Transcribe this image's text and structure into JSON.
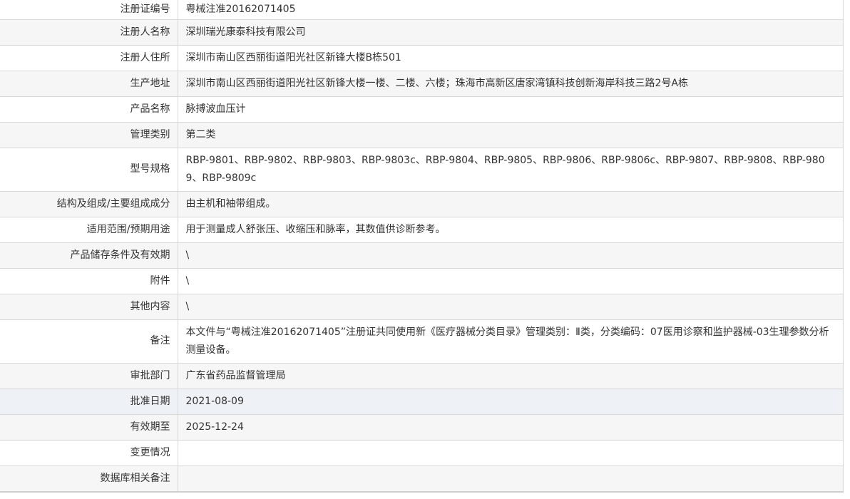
{
  "rows": [
    {
      "label": "注册证编号",
      "value": "粤械注准20162071405"
    },
    {
      "label": "注册人名称",
      "value": "深圳瑞光康泰科技有限公司"
    },
    {
      "label": "注册人住所",
      "value": "深圳市南山区西丽街道阳光社区新锋大楼B栋501"
    },
    {
      "label": "生产地址",
      "value": "深圳市南山区西丽街道阳光社区新锋大楼一楼、二楼、六楼；珠海市高新区唐家湾镇科技创新海岸科技三路2号A栋"
    },
    {
      "label": "产品名称",
      "value": "脉搏波血压计"
    },
    {
      "label": "管理类别",
      "value": "第二类"
    },
    {
      "label": "型号规格",
      "value": "RBP-9801、RBP-9802、RBP-9803、RBP-9803c、RBP-9804、RBP-9805、RBP-9806、RBP-9806c、RBP-9807、RBP-9808、RBP-9809、RBP-9809c"
    },
    {
      "label": "结构及组成/主要组成成分",
      "value": "由主机和袖带组成。"
    },
    {
      "label": "适用范围/预期用途",
      "value": "用于测量成人舒张压、收缩压和脉率，其数值供诊断参考。"
    },
    {
      "label": "产品储存条件及有效期",
      "value": "\\"
    },
    {
      "label": "附件",
      "value": "\\"
    },
    {
      "label": "其他内容",
      "value": "\\"
    },
    {
      "label": "备注",
      "value": "本文件与“粤械注准20162071405”注册证共同使用新《医疗器械分类目录》管理类别：Ⅱ类，分类编码：07医用诊察和监护器械-03生理参数分析测量设备。"
    },
    {
      "label": "审批部门",
      "value": "广东省药品监督管理局"
    },
    {
      "label": "批准日期",
      "value": "2021-08-09"
    },
    {
      "label": "有效期至",
      "value": "2025-12-24"
    },
    {
      "label": "变更情况",
      "value": ""
    },
    {
      "label": "数据库相关备注",
      "value": ""
    }
  ]
}
